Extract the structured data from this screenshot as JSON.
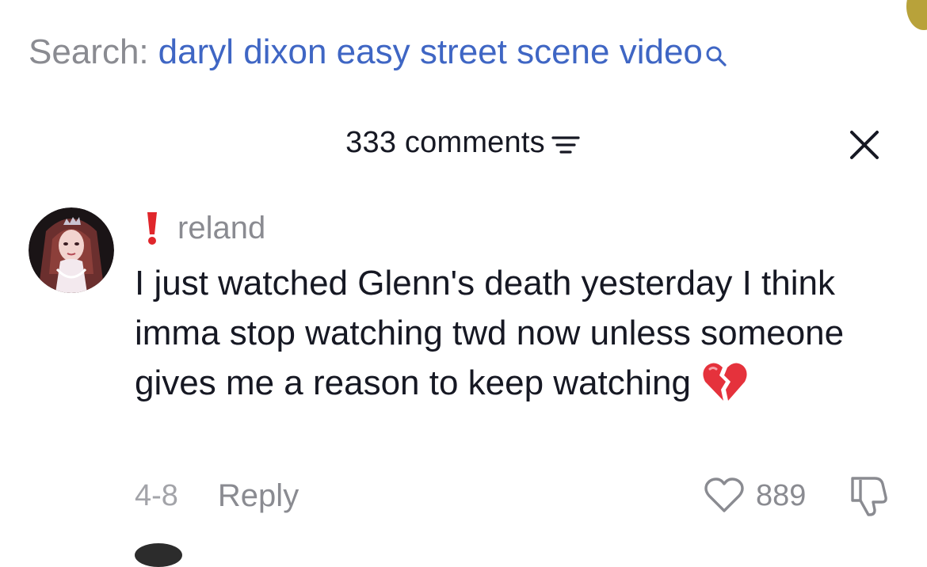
{
  "search": {
    "prefix": "Search:",
    "query": "daryl dixon easy street scene video",
    "icon": "search-icon"
  },
  "comments_panel": {
    "count_label": "333 comments",
    "sort_icon": "sort-icon",
    "close_icon": "close-icon"
  },
  "comment": {
    "username": "reland",
    "badge_icon": "red-exclamation-icon",
    "text": "I just watched Glenn's death yesterday I think imma stop watching twd now unless someone gives me a reason to keep watching",
    "emoji": "broken-heart-icon",
    "date": "4-8",
    "reply_label": "Reply",
    "like_count": "889",
    "like_icon": "heart-outline-icon",
    "dislike_icon": "thumbs-down-icon"
  },
  "colors": {
    "search_query": "#3f66c4",
    "muted_text": "#8a8b91",
    "primary_text": "#161823",
    "warning_red": "#e0262b",
    "broken_heart_red": "#e5323c"
  }
}
